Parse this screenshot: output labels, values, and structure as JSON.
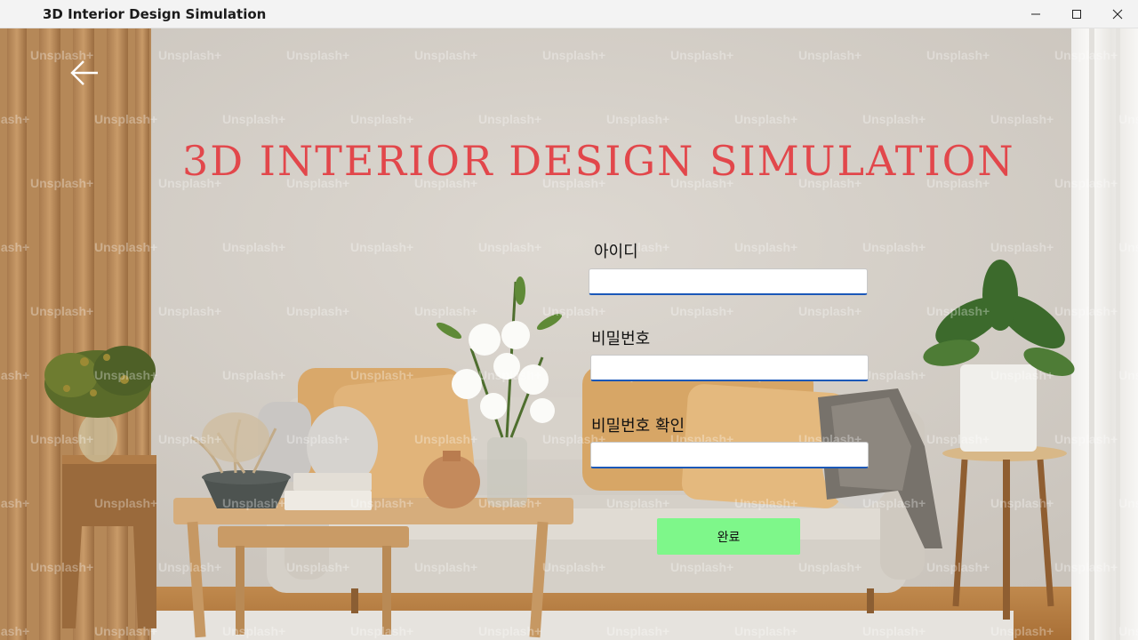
{
  "window": {
    "title": "3D Interior Design Simulation"
  },
  "page": {
    "heading": "3D INTERIOR DESIGN SIMULATION",
    "watermark_text": "Unsplash+"
  },
  "form": {
    "id_label": "아이디",
    "id_value": "",
    "password_label": "비밀번호",
    "password_value": "",
    "password_confirm_label": "비밀번호 확인",
    "password_confirm_value": "",
    "submit_label": "완료"
  },
  "colors": {
    "title_color": "#e2474b",
    "submit_bg": "#7ef78a",
    "input_accent": "#1b58b8"
  }
}
